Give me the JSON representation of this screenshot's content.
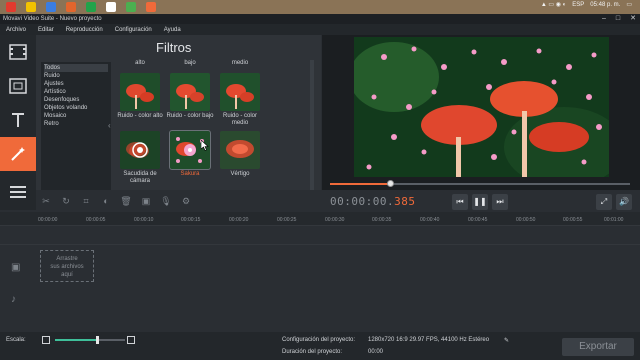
{
  "taskbar": {
    "lang": "ESP",
    "clock": "05:48 p. m.",
    "icon_colors": [
      "#e23b2e",
      "#f2c200",
      "#3b7de0",
      "#e2652d",
      "#22a34a",
      "#ffffff",
      "#4caf50",
      "#f06a3a"
    ]
  },
  "window": {
    "title": "Movavi Video Suite - Nuevo proyecto",
    "minimize": "–",
    "maximize": "□",
    "close": "✕"
  },
  "menu": {
    "items": [
      "Archivo",
      "Editar",
      "Reproducción",
      "Configuración",
      "Ayuda"
    ]
  },
  "sidebar": {
    "items": [
      "media-icon",
      "titles-icon",
      "text-icon",
      "effects-wand-icon",
      "menu-icon"
    ],
    "active_index": 3,
    "accent": "#f06a3a"
  },
  "filters": {
    "title": "Filtros",
    "categories": [
      "Todos",
      "Ruido",
      "Ajustes",
      "Artístico",
      "Desenfoques",
      "Objetos volando",
      "Mosaico",
      "Retro"
    ],
    "selected_category": "Todos",
    "top_partial_labels": [
      "alto",
      "bajo",
      "medio"
    ],
    "thumbs": [
      {
        "label": "Ruido - color alto"
      },
      {
        "label": "Ruido - color bajo"
      },
      {
        "label": "Ruido - color medio"
      },
      {
        "label": "Sacudida de cámara"
      },
      {
        "label": "Sakura",
        "selected": true
      },
      {
        "label": "Vértigo"
      }
    ]
  },
  "player": {
    "timecode_main": "00:00:00.",
    "timecode_ms": "385",
    "progress": 0.2,
    "buttons": [
      "skip-back-icon",
      "pause-icon",
      "skip-forward-icon",
      "fullscreen-icon",
      "volume-icon"
    ]
  },
  "toolbar": {
    "tools": [
      "cut-icon",
      "rotate-icon",
      "crop-icon",
      "color-icon",
      "delete-icon",
      "image-icon",
      "mic-icon",
      "settings-icon"
    ]
  },
  "ruler": {
    "ticks": [
      "00:00:00",
      "00:00:05",
      "00:00:10",
      "00:00:15",
      "00:00:20",
      "00:00:25",
      "00:00:30",
      "00:00:35",
      "00:00:40",
      "00:00:45",
      "00:00:50",
      "00:00:55",
      "00:01:00"
    ]
  },
  "timeline": {
    "drop_zone_lines": [
      "Arrastre",
      "sus archivos",
      "aquí"
    ],
    "track_icons": [
      "video-track-icon",
      "audio-track-icon"
    ]
  },
  "bottom": {
    "scale_label": "Escala:",
    "scale_level": 0.6,
    "project_config_label": "Configuración del proyecto:",
    "project_config_value": "1280x720 16:9 29.97 FPS, 44100 Hz Estéreo",
    "duration_label": "Duración del proyecto:",
    "duration_value": "00:00",
    "export_label": "Exportar"
  }
}
